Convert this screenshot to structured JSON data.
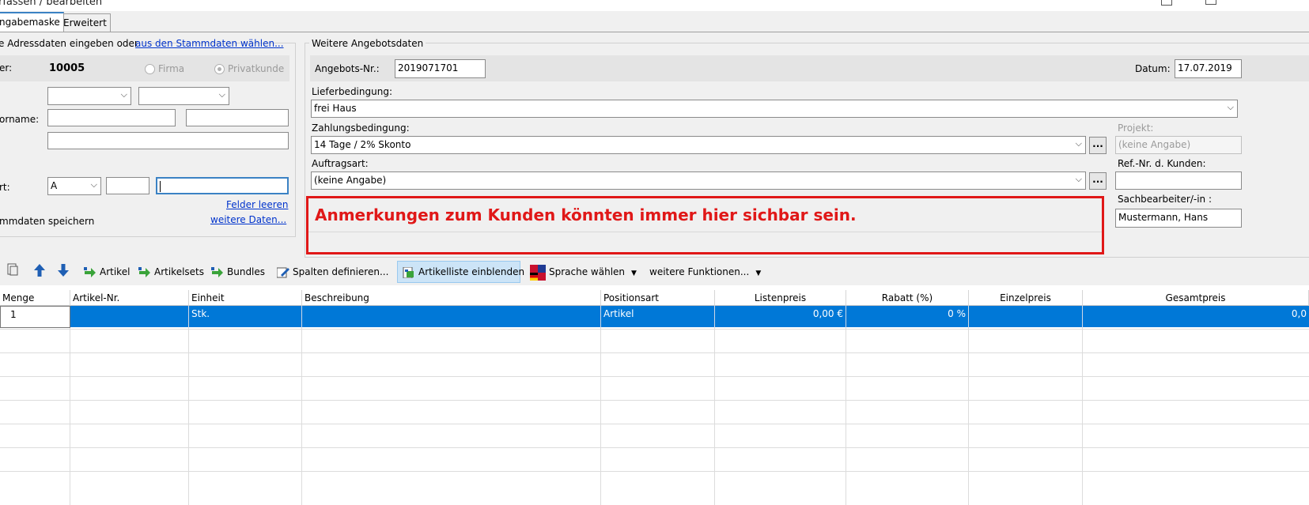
{
  "window": {
    "title": "rfassen / bearbeiten"
  },
  "tabs": [
    {
      "label": "ngabemaske"
    },
    {
      "label": "Erweitert"
    }
  ],
  "address": {
    "prompt": "e Adressdaten eingeben oder",
    "choose_link": "aus den Stammdaten wählen...",
    "number_label": "er:",
    "number_value": "10005",
    "radio_firma": "Firma",
    "radio_privat": "Privatkunde",
    "name_label": "orname:",
    "ort_label": "rt:",
    "country_value": "A",
    "clear_link": "Felder leeren",
    "more_link": "weitere Daten...",
    "save_label": "mmdaten speichern"
  },
  "offer": {
    "group_title": "Weitere Angebotsdaten",
    "number_label": "Angebots-Nr.:",
    "number_value": "2019071701",
    "date_label": "Datum:",
    "date_value": "17.07.2019",
    "delivery_label": "Lieferbedingung:",
    "delivery_value": "frei Haus",
    "payment_label": "Zahlungsbedingung:",
    "payment_value": "14 Tage / 2% Skonto",
    "ordertype_label": "Auftragsart:",
    "ordertype_value": "(keine Angabe)",
    "dots": "...",
    "project_label": "Projekt:",
    "project_value": "(keine Angabe)",
    "ref_label": "Ref.-Nr. d. Kunden:",
    "ref_value": "",
    "clerk_label": "Sachbearbeiter/-in :",
    "clerk_value": "Mustermann, Hans"
  },
  "notes": {
    "text": "Anmerkungen zum Kunden könnten immer hier sichbar sein."
  },
  "toolbar": {
    "artikel": "Artikel",
    "artikelsets": "Artikelsets",
    "bundles": "Bundles",
    "spalten": "Spalten definieren...",
    "artikelliste": "Artikelliste einblenden",
    "sprache": "Sprache wählen",
    "weitere": "weitere Funktionen..."
  },
  "grid": {
    "columns": [
      "Menge",
      "Artikel-Nr.",
      "Einheit",
      "Beschreibung",
      "Positionsart",
      "Listenpreis",
      "Rabatt (%)",
      "Einzelpreis",
      "Gesamtpreis"
    ],
    "rows": [
      {
        "menge": "1",
        "artikelnr": "",
        "einheit": "Stk.",
        "beschreibung": "",
        "positionsart": "Artikel",
        "listenpreis": "0,00 €",
        "rabatt": "0 %",
        "einzelpreis": "",
        "gesamtpreis": "0,0"
      }
    ]
  },
  "colors": {
    "accent": "#0078d7",
    "notes_border": "#e01818",
    "link": "#0033cc"
  }
}
